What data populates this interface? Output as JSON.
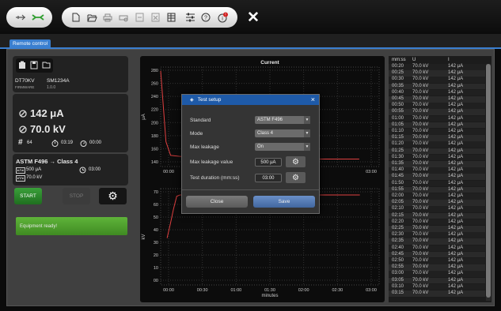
{
  "toolbar": {
    "usb_icon": "⇌",
    "link_icon": "⋈",
    "close_icon": "✕"
  },
  "tab": {
    "label": "Remote control"
  },
  "device": {
    "model": "DT70KV",
    "serial": "SM1234A",
    "firmware_label": "FIRMWARE",
    "firmware": "1.0.0"
  },
  "readings": {
    "current": "142 μA",
    "voltage": "70.0 kV",
    "count": "64",
    "elapsed": "03:19",
    "remaining": "00:00"
  },
  "test": {
    "title": "ASTM F496 → Class 4",
    "max_leakage": "500 μA",
    "max_leakage_tag": "▸A◂",
    "duration": "03:00",
    "voltage": "70.0 kV",
    "voltage_tag": "▸V◂"
  },
  "controls": {
    "start": "START",
    "stop": "STOP"
  },
  "status": "Equipment ready!",
  "chart_data": [
    {
      "type": "line",
      "title": "Current",
      "ylabel": "μA",
      "yticks": [
        "140",
        "160",
        "180",
        "200",
        "220",
        "240",
        "260",
        "280"
      ],
      "xticks": [
        "00:00",
        "",
        "",
        "",
        "",
        "",
        "03:00"
      ],
      "x": [
        0,
        0.08,
        0.15,
        0.5,
        1.0,
        1.5,
        2.0,
        2.5,
        3.0
      ],
      "values": [
        284,
        170,
        148,
        144,
        143,
        142,
        142,
        142,
        142
      ],
      "ylim": [
        130,
        290
      ],
      "xlim": [
        0,
        3.3
      ]
    },
    {
      "type": "line",
      "title": "",
      "ylabel": "kV",
      "xlabel": "minutes",
      "yticks": [
        "00",
        "10",
        "20",
        "30",
        "40",
        "50",
        "60",
        "70"
      ],
      "xticks": [
        "00:00",
        "00:30",
        "01:00",
        "01:30",
        "02:00",
        "02:30",
        "03:00"
      ],
      "x": [
        0.0,
        0.05,
        0.1,
        0.15,
        0.2,
        0.5,
        1.0,
        1.5,
        2.0,
        2.5,
        3.0
      ],
      "values": [
        37,
        48,
        60,
        70,
        71,
        71,
        71,
        71,
        71,
        71,
        71
      ],
      "ylim": [
        0,
        76
      ],
      "xlim": [
        -0.1,
        3.3
      ]
    }
  ],
  "table": {
    "headers": [
      "mm:ss",
      "U",
      "I"
    ],
    "rows": [
      [
        "00:20",
        "70.0 kV",
        "142 μA"
      ],
      [
        "00:25",
        "70.0 kV",
        "142 μA"
      ],
      [
        "00:30",
        "70.0 kV",
        "142 μA"
      ],
      [
        "00:35",
        "70.0 kV",
        "142 μA"
      ],
      [
        "00:40",
        "70.0 kV",
        "142 μA"
      ],
      [
        "00:45",
        "70.0 kV",
        "142 μA"
      ],
      [
        "00:50",
        "70.0 kV",
        "142 μA"
      ],
      [
        "00:55",
        "70.0 kV",
        "142 μA"
      ],
      [
        "01:00",
        "70.0 kV",
        "142 μA"
      ],
      [
        "01:05",
        "70.0 kV",
        "142 μA"
      ],
      [
        "01:10",
        "70.0 kV",
        "142 μA"
      ],
      [
        "01:15",
        "70.0 kV",
        "142 μA"
      ],
      [
        "01:20",
        "70.0 kV",
        "142 μA"
      ],
      [
        "01:25",
        "70.0 kV",
        "142 μA"
      ],
      [
        "01:30",
        "70.0 kV",
        "142 μA"
      ],
      [
        "01:35",
        "70.0 kV",
        "142 μA"
      ],
      [
        "01:40",
        "70.0 kV",
        "142 μA"
      ],
      [
        "01:45",
        "70.0 kV",
        "142 μA"
      ],
      [
        "01:50",
        "70.0 kV",
        "142 μA"
      ],
      [
        "01:55",
        "70.0 kV",
        "142 μA"
      ],
      [
        "02:00",
        "70.0 kV",
        "142 μA"
      ],
      [
        "02:05",
        "70.0 kV",
        "142 μA"
      ],
      [
        "02:10",
        "70.0 kV",
        "142 μA"
      ],
      [
        "02:15",
        "70.0 kV",
        "142 μA"
      ],
      [
        "02:20",
        "70.0 kV",
        "142 μA"
      ],
      [
        "02:25",
        "70.0 kV",
        "142 μA"
      ],
      [
        "02:30",
        "70.0 kV",
        "142 μA"
      ],
      [
        "02:35",
        "70.0 kV",
        "142 μA"
      ],
      [
        "02:40",
        "70.0 kV",
        "142 μA"
      ],
      [
        "02:45",
        "70.0 kV",
        "142 μA"
      ],
      [
        "02:50",
        "70.0 kV",
        "142 μA"
      ],
      [
        "02:55",
        "70.0 kV",
        "142 μA"
      ],
      [
        "03:00",
        "70.0 kV",
        "142 μA"
      ],
      [
        "03:05",
        "70.0 kV",
        "142 μA"
      ],
      [
        "03:10",
        "70.0 kV",
        "142 μA"
      ],
      [
        "03:15",
        "70.0 kV",
        "142 μA"
      ]
    ]
  },
  "dialog": {
    "title": "Test setup",
    "close_icon": "×",
    "standard_label": "Standard",
    "standard_value": "ASTM F496",
    "mode_label": "Mode",
    "mode_value": "Class 4",
    "max_leakage_label": "Max leakage",
    "max_leakage_value": "On",
    "max_leakage_value_label": "Max leakage value",
    "max_leakage_value_value": "500 μA",
    "duration_label": "Test duration (mm:ss)",
    "duration_value": "03:00",
    "close_button": "Close",
    "save_button": "Save"
  },
  "colors": {
    "accent": "#3a7fd0",
    "start": "#2e8b2e",
    "status": "#4f9e27",
    "line": "#e04040"
  }
}
